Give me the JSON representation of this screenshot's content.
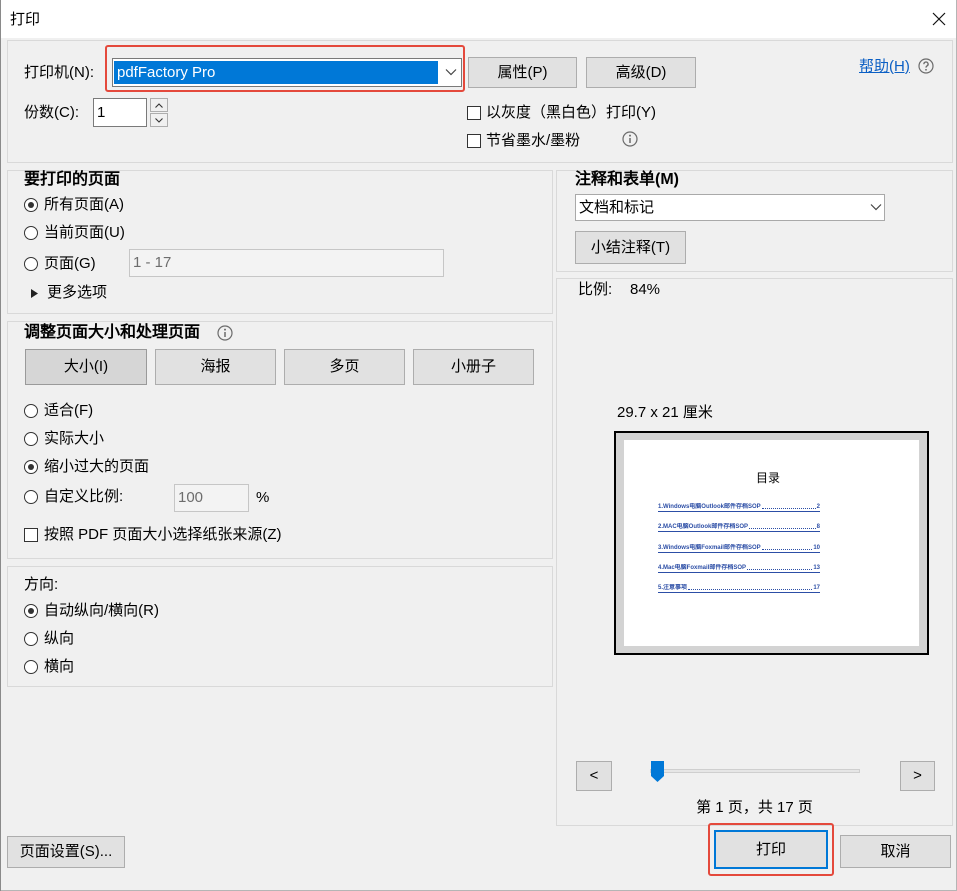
{
  "window": {
    "title": "打印"
  },
  "printer": {
    "label": "打印机(N):",
    "selected": "pdfFactory Pro",
    "properties_button": "属性(P)",
    "advanced_button": "高级(D)",
    "help_link": "帮助(H)"
  },
  "copies": {
    "label": "份数(C):",
    "value": "1"
  },
  "print_options": {
    "grayscale": {
      "label": "以灰度（黑白色）打印(Y)",
      "checked": false
    },
    "save_ink": {
      "label": "节省墨水/墨粉",
      "checked": false
    }
  },
  "pages_to_print": {
    "title": "要打印的页面",
    "options": [
      {
        "label": "所有页面(A)",
        "checked": true
      },
      {
        "label": "当前页面(U)",
        "checked": false
      },
      {
        "label": "页面(G)",
        "checked": false
      }
    ],
    "page_range": "1 - 17",
    "more_options": "更多选项"
  },
  "page_sizing": {
    "title": "调整页面大小和处理页面",
    "tabs": [
      {
        "label": "大小(I)",
        "active": true
      },
      {
        "label": "海报",
        "active": false
      },
      {
        "label": "多页",
        "active": false
      },
      {
        "label": "小册子",
        "active": false
      }
    ],
    "options": [
      {
        "label": "适合(F)",
        "checked": false
      },
      {
        "label": "实际大小",
        "checked": false
      },
      {
        "label": "缩小过大的页面",
        "checked": true
      },
      {
        "label": "自定义比例:",
        "checked": false
      }
    ],
    "custom_scale": "100",
    "percent_sign": "%",
    "paper_source": {
      "label": "按照 PDF 页面大小选择纸张来源(Z)",
      "checked": false
    }
  },
  "orientation": {
    "title": "方向:",
    "options": [
      {
        "label": "自动纵向/横向(R)",
        "checked": true
      },
      {
        "label": "纵向",
        "checked": false
      },
      {
        "label": "横向",
        "checked": false
      }
    ]
  },
  "comments_and_forms": {
    "title": "注释和表单(M)",
    "selected": "文档和标记",
    "summarize_button": "小结注释(T)"
  },
  "preview": {
    "scale_label": "比例:",
    "scale_value": "84%",
    "paper_size": "29.7 x 21 厘米",
    "page_content": {
      "heading": "目录",
      "toc": [
        {
          "title": "1.Windows电脑Outlook邮件存档SOP",
          "page": "2"
        },
        {
          "title": "2.MAC电脑Outlook邮件存档SOP",
          "page": "8"
        },
        {
          "title": "3.Windows电脑Foxmail邮件存档SOP",
          "page": "10"
        },
        {
          "title": "4.Mac电脑Foxmail邮件存档SOP",
          "page": "13"
        },
        {
          "title": "5.注意事项",
          "page": "17"
        }
      ]
    },
    "prev_button": "<",
    "next_button": ">",
    "current_page": 1,
    "total_pages": 17,
    "page_indicator": "第 1 页，共 17 页"
  },
  "footer": {
    "page_setup_button": "页面设置(S)...",
    "print_button": "打印",
    "cancel_button": "取消"
  },
  "icons": {
    "close": "close-icon",
    "dropdown": "chevron-down-icon",
    "help": "help-circle-icon",
    "info": "info-icon",
    "expand": "triangle-right-icon",
    "spin_up": "spin-up-icon",
    "spin_down": "spin-down-icon",
    "slider_thumb": "slider-thumb-icon"
  },
  "colors": {
    "accent": "#0078d7",
    "annotation": "#e4493c",
    "link": "#0b5fc4",
    "toc_text": "#2c4ea6"
  }
}
